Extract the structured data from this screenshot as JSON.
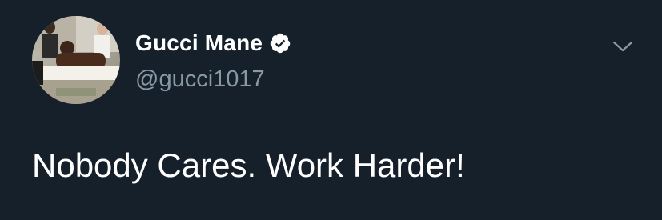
{
  "tweet": {
    "author": {
      "display_name": "Gucci Mane",
      "handle": "@gucci1017",
      "verified": true,
      "avatar_icon": "profile-photo"
    },
    "text": "Nobody Cares. Work Harder!",
    "menu_icon": "chevron-down-icon"
  },
  "colors": {
    "background": "#15202b",
    "primary_text": "#ffffff",
    "secondary_text": "#8899a6",
    "verified_badge": "#ffffff"
  }
}
